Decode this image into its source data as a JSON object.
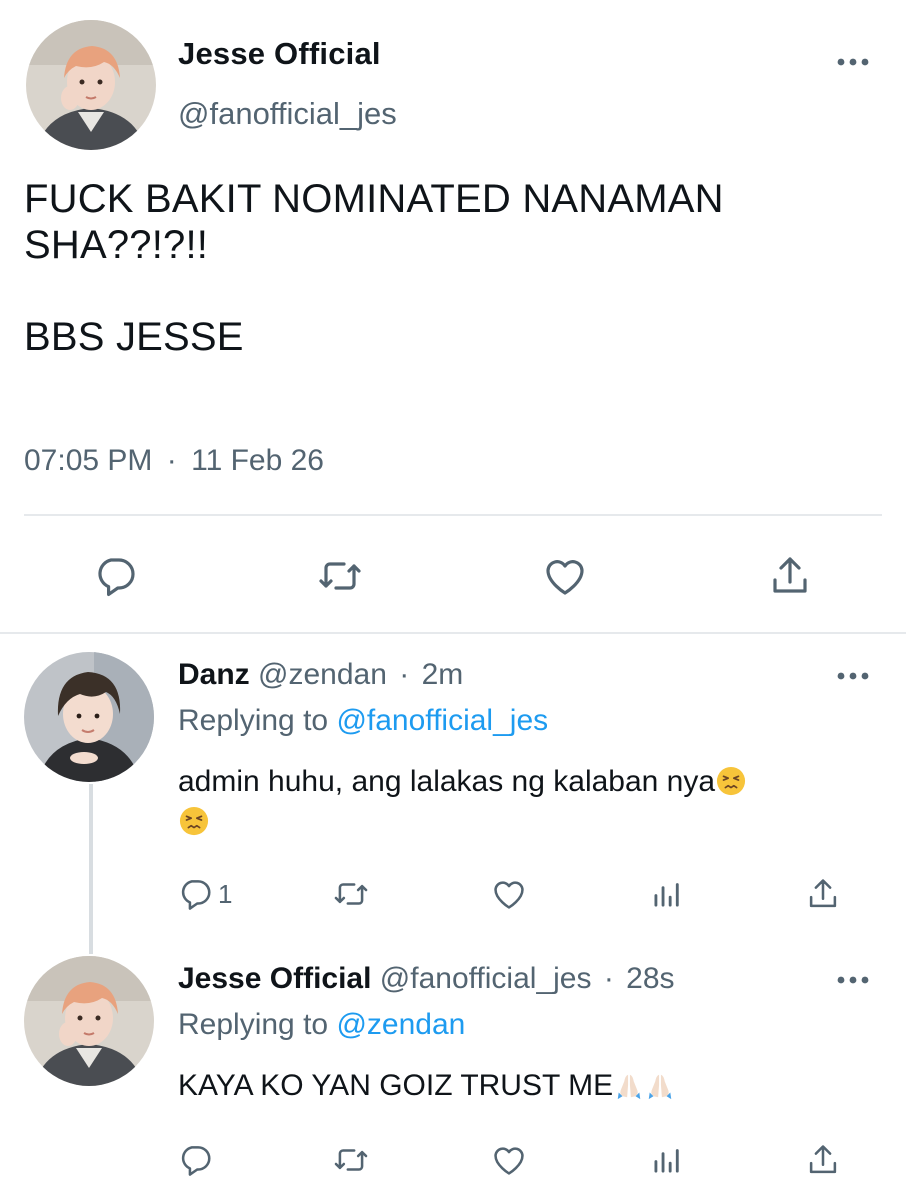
{
  "main_tweet": {
    "display_name": "Jesse Official",
    "handle": "@fanofficial_jes",
    "text": "FUCK BAKIT NOMINATED NANAMAN\nSHA??!?!!\n\nBBS JESSE",
    "time": "07:05 PM",
    "separator": "·",
    "date": "11 Feb 26",
    "actions": [
      "reply-icon",
      "retweet-icon",
      "like-icon",
      "share-icon"
    ]
  },
  "replies": [
    {
      "display_name": "Danz",
      "handle": "@zendan",
      "separator": "·",
      "time_ago": "2m",
      "replying_prefix": "Replying to",
      "replying_to": "@fanofficial_jes",
      "text": "admin huhu, ang lalakas ng kalaban nya",
      "emoji": [
        "persevering-face-emoji",
        "persevering-face-emoji"
      ],
      "reply_count": "1",
      "actions": [
        "reply-icon",
        "retweet-icon",
        "like-icon",
        "analytics-icon",
        "share-icon"
      ]
    },
    {
      "display_name": "Jesse Official",
      "handle": "@fanofficial_jes",
      "separator": "·",
      "time_ago": "28s",
      "replying_prefix": "Replying to",
      "replying_to": "@zendan",
      "text": "KAYA KO YAN GOIZ TRUST ME",
      "emoji": [
        "folded-hands-emoji",
        "folded-hands-emoji"
      ],
      "reply_count": "",
      "actions": [
        "reply-icon",
        "retweet-icon",
        "like-icon",
        "analytics-icon",
        "share-icon"
      ]
    }
  ],
  "colors": {
    "text": "#0f1419",
    "secondary": "#536471",
    "link": "#1d9bf0",
    "divider": "#e6e9ec",
    "icon": "#536471"
  }
}
